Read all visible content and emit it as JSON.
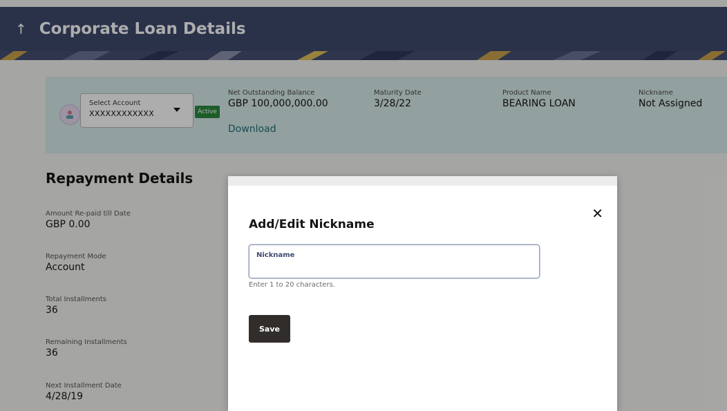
{
  "header": {
    "back_icon": "up-arrow-icon",
    "back_glyph": "↑",
    "title": "Corporate Loan Details"
  },
  "account": {
    "select_label": "Select Account",
    "select_value": "XXXXXXXXXXXX",
    "status": "Active",
    "net_outstanding_label": "Net Outstanding Balance",
    "net_outstanding_value": "GBP 100,000,000.00",
    "maturity_label": "Maturity Date",
    "maturity_value": "3/28/22",
    "product_label": "Product Name",
    "product_value": "BEARING LOAN",
    "nickname_label": "Nickname",
    "nickname_value": "Not Assigned",
    "download_label": "Download"
  },
  "repayment": {
    "title": "Repayment Details",
    "items": [
      {
        "label": "Amount Re-paid till Date",
        "value": "GBP 0.00"
      },
      {
        "label": "Repayment Mode",
        "value": "Account"
      },
      {
        "label": "Total Installments",
        "value": "36"
      },
      {
        "label": "Remaining Installments",
        "value": "36"
      },
      {
        "label": "Next Installment Date",
        "value": "4/28/19"
      }
    ]
  },
  "modal": {
    "title": "Add/Edit Nickname",
    "close_glyph": "✕",
    "field_label": "Nickname",
    "field_value": "",
    "hint": "Enter 1 to 20 characters.",
    "save_label": "Save"
  },
  "colors": {
    "header_bg": "#3f4a6e",
    "strip_bg": "#d8ecea",
    "active_badge": "#2b8a3e",
    "link": "#21707a",
    "save_button": "#312d2a"
  }
}
